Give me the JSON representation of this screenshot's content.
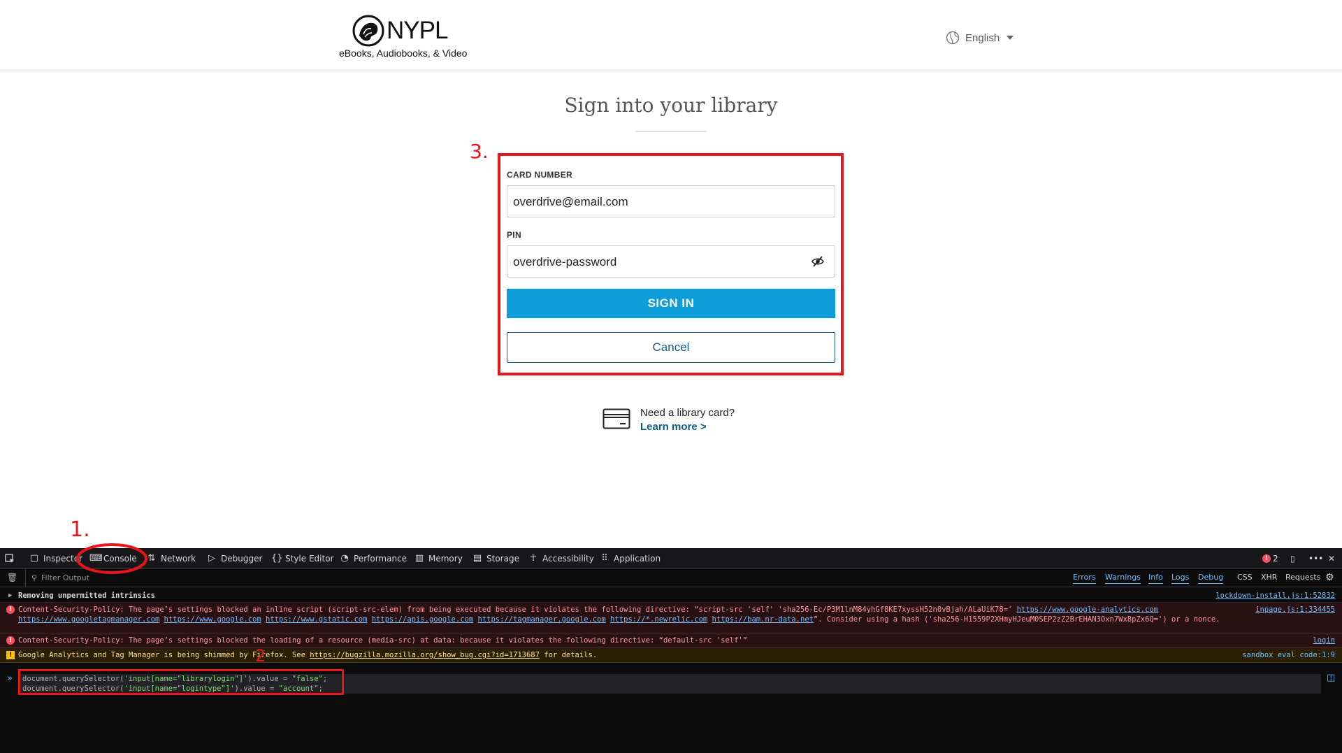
{
  "header": {
    "logo_name": "NYPL",
    "logo_tagline": "eBooks, Audiobooks, & Video",
    "language": "English"
  },
  "signin": {
    "title": "Sign into your library",
    "card_number_label": "CARD NUMBER",
    "card_number_value": "overdrive@email.com",
    "pin_label": "PIN",
    "pin_value": "overdrive-password",
    "sign_in_button": "SIGN IN",
    "cancel_button": "Cancel",
    "card_question": "Need a library card?",
    "learn_more": "Learn more >"
  },
  "annotations": {
    "step1": "1.",
    "step2": "2",
    "step3": "3."
  },
  "devtools": {
    "tabs": [
      "Inspector",
      "Console",
      "Network",
      "Debugger",
      "Style Editor",
      "Performance",
      "Memory",
      "Storage",
      "Accessibility",
      "Application"
    ],
    "active_tab": "Console",
    "error_count": "2",
    "filter_placeholder": "Filter Output",
    "filters": [
      "Errors",
      "Warnings",
      "Info",
      "Logs",
      "Debug"
    ],
    "filters_extra": [
      "CSS",
      "XHR",
      "Requests"
    ],
    "messages": [
      {
        "level": "log",
        "text": "Removing unpermitted intrinsics",
        "source": "lockdown-install.js:1:52832"
      },
      {
        "level": "error",
        "text_pre": "Content-Security-Policy: The page’s settings blocked an inline script (script-src-elem) from being executed because it violates the following directive: “script-src 'self' 'sha256-Ec/P3M1lnM84yhGf8KE7xyssH52n0vBjah/ALaUiK78=' ",
        "links": [
          "https://www.google-analytics.com",
          "https://www.googletagmanager.com",
          "https://www.google.com",
          "https://www.gstatic.com",
          "https://apis.google.com",
          "https://tagmanager.google.com",
          "https://*.newrelic.com",
          "https://bam.nr-data.net"
        ],
        "text_post": "”. Consider using a hash ('sha256-H1559P2XHmyHJeuM0SEP2zZ2BrEHAN3Oxn7Wx8pZx6Q=') or a nonce.",
        "source": "inpage.js:1:334455"
      },
      {
        "level": "error",
        "text": "Content-Security-Policy: The page’s settings blocked the loading of a resource (media-src) at data: because it violates the following directive: “default-src 'self'”",
        "source": "login"
      },
      {
        "level": "warn",
        "text_pre": "Google Analytics and Tag Manager is being shimmed by Firefox. See ",
        "link": "https://bugzilla.mozilla.org/show_bug.cgi?id=1713687",
        "text_post": " for details.",
        "source": "sandbox eval code:1:9"
      }
    ],
    "input_lines": [
      {
        "a": "document.querySelector(",
        "b": "'input[name=\"librarylogin\"]'",
        "c": ").value = ",
        "d": "\"false\"",
        "e": ";"
      },
      {
        "a": "document.querySelector(",
        "b": "'input[name=\"logintype\"]'",
        "c": ").value = ",
        "d": "\"account\"",
        "e": ";"
      }
    ]
  },
  "colors": {
    "accent": "#0d9dd8",
    "link": "#135b8c",
    "annotation": "#e8161b"
  }
}
